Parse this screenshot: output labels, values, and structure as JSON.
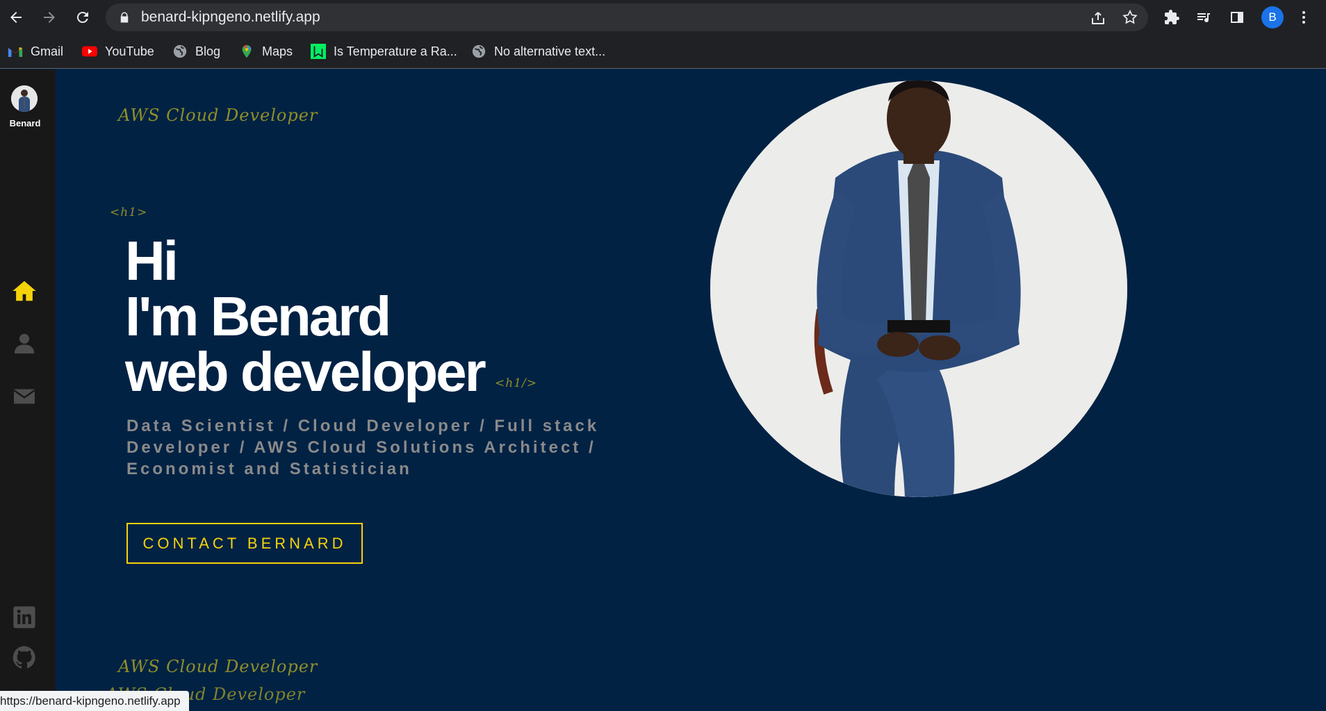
{
  "browser": {
    "url": "benard-kipngeno.netlify.app",
    "profile_initial": "B",
    "status_url": "https://benard-kipngeno.netlify.app"
  },
  "bookmarks": [
    {
      "label": "Gmail",
      "icon": "gmail-icon"
    },
    {
      "label": "YouTube",
      "icon": "youtube-icon"
    },
    {
      "label": "Blog",
      "icon": "globe-icon"
    },
    {
      "label": "Maps",
      "icon": "maps-icon"
    },
    {
      "label": "Is Temperature a Ra...",
      "icon": "datacamp-icon"
    },
    {
      "label": "No alternative text...",
      "icon": "globe-icon"
    }
  ],
  "sidebar": {
    "brand_name": "Benard",
    "items": [
      "home-icon",
      "user-icon",
      "envelope-icon"
    ],
    "social": [
      "linkedin-icon",
      "github-icon"
    ]
  },
  "hero": {
    "tag_top": "AWS Cloud Developer",
    "h1_open": "<h1>",
    "line1": "Hi",
    "line2": "I'm Benard",
    "line3": "web developer",
    "h1_close": "<h1/>",
    "subtitle": "Data Scientist / Cloud Developer / Full stack Developer / AWS Cloud Solutions Architect / Economist and Statistician",
    "cta_label": "CONTACT BERNARD",
    "tag_bottom": "AWS Cloud Developer",
    "tag_bottom2": "AWS Cloud Developer"
  },
  "colors": {
    "page_bg": "#022244",
    "sidebar_bg": "#181818",
    "accent_yellow": "#f5d30a",
    "script_olive": "#8f8f28",
    "subtitle_gray": "#8a8a8a"
  }
}
